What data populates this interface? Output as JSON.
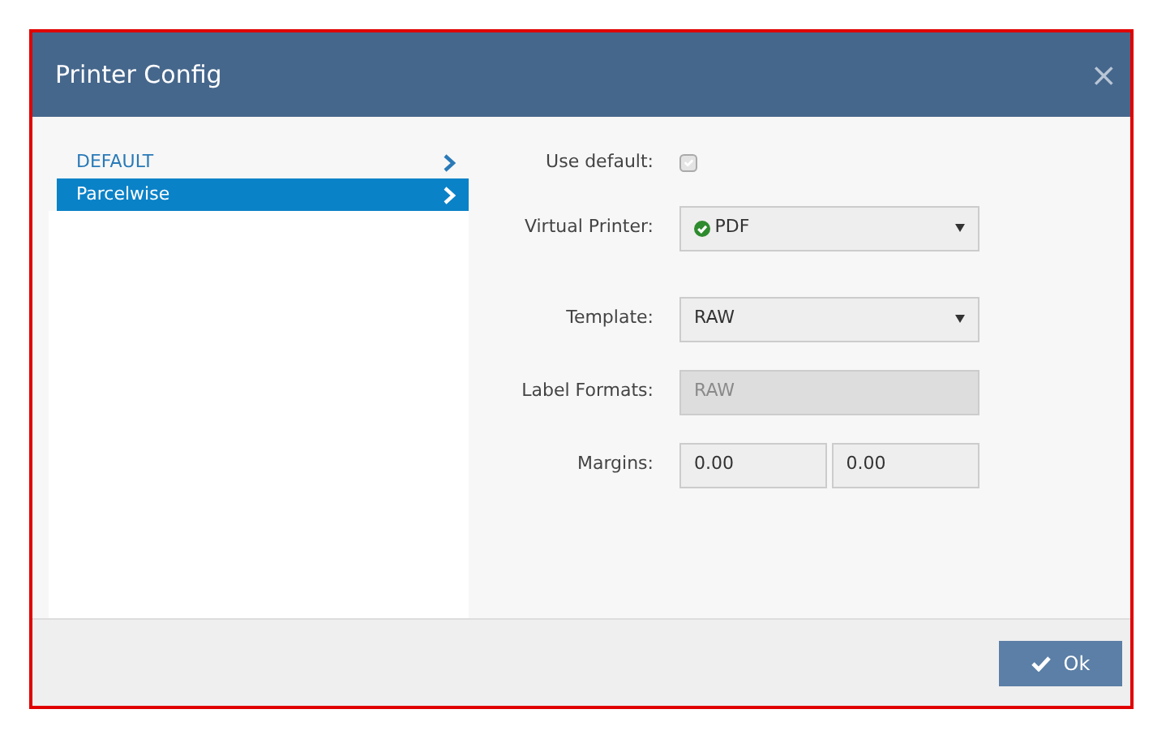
{
  "window": {
    "title": "Printer Config",
    "close": "×"
  },
  "sidebar": {
    "items": [
      {
        "label": "DEFAULT",
        "selected": false
      },
      {
        "label": "Parcelwise",
        "selected": true
      }
    ]
  },
  "form": {
    "fields": [
      {
        "kind": "checkbox",
        "label": "Use default:",
        "checked": true
      },
      {
        "kind": "select",
        "label": "Virtual Printer:",
        "value": "PDF",
        "status_icon": true
      },
      {
        "kind": "select",
        "label": "Template:",
        "value": "RAW"
      },
      {
        "kind": "text",
        "label": "Label Formats:",
        "value": "RAW",
        "disabled": true
      },
      {
        "kind": "pair",
        "label": "Margins:",
        "values": [
          "0.00",
          "0.00"
        ]
      }
    ]
  },
  "footer": {
    "buttons": [
      {
        "label": "Ok"
      }
    ]
  }
}
